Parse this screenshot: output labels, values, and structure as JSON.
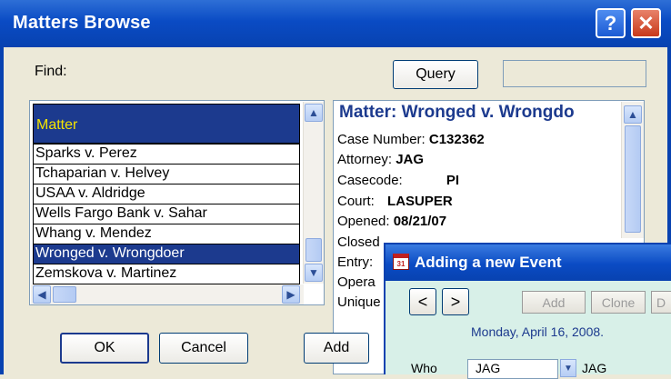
{
  "window": {
    "title": "Matters Browse",
    "help_glyph": "?",
    "close_glyph": "✕"
  },
  "find": {
    "label": "Find:",
    "query_label": "Query",
    "query_value": ""
  },
  "list": {
    "header": "Matter",
    "rows": [
      {
        "label": "Sparks v. Perez",
        "selected": false
      },
      {
        "label": "Tchaparian v. Helvey",
        "selected": false
      },
      {
        "label": "USAA v. Aldridge",
        "selected": false
      },
      {
        "label": "Wells Fargo Bank v. Sahar",
        "selected": false
      },
      {
        "label": "Whang v. Mendez",
        "selected": false
      },
      {
        "label": "Wronged v. Wrongdoer",
        "selected": true
      },
      {
        "label": "Zemskova v. Martinez",
        "selected": false
      }
    ]
  },
  "details": {
    "title": "Matter: Wronged v. Wrongdo",
    "fields": [
      {
        "label": "Case Number:",
        "value": "C132362"
      },
      {
        "label": "Attorney:",
        "value": "JAG"
      },
      {
        "label": "Casecode:",
        "value": "PI"
      },
      {
        "label": "Court:",
        "value": "LASUPER"
      },
      {
        "label": "Opened:",
        "value": "08/21/07"
      },
      {
        "label": "Closed",
        "value": ""
      },
      {
        "label": "Entry:",
        "value": ""
      },
      {
        "label": "Opera",
        "value": ""
      },
      {
        "label": "Unique",
        "value": ""
      }
    ]
  },
  "buttons": {
    "ok": "OK",
    "cancel": "Cancel",
    "add": "Add"
  },
  "event_dialog": {
    "title": "Adding a new Event",
    "icon_text": "31",
    "prev": "<",
    "next": ">",
    "add": "Add",
    "clone": "Clone",
    "delete_partial": "D",
    "date": "Monday, April 16, 2008.",
    "who_label": "Who",
    "who_input": "JAG",
    "who_value": "JAG"
  },
  "colors": {
    "titlebar": "#0A4BC4",
    "selection": "#1C3A8E",
    "header_text": "#F5E400",
    "dialog_bg": "#D8F0E8"
  }
}
